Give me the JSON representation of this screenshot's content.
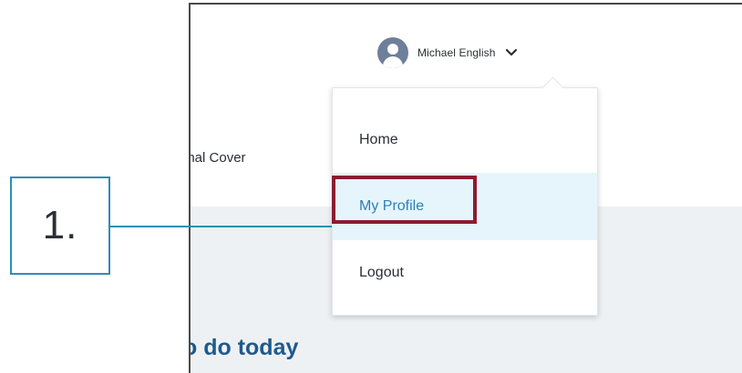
{
  "header": {
    "user_name": "Michael English",
    "avatar_icon": "user-avatar-icon",
    "dropdown_icon": "chevron-down-icon"
  },
  "nav": {
    "partial_text": "onal Cover"
  },
  "dropdown": {
    "items": [
      {
        "label": "Home"
      },
      {
        "label": "My Profile",
        "highlighted": true
      },
      {
        "label": "Logout"
      }
    ]
  },
  "content": {
    "heading_partial": "o do today"
  },
  "callout": {
    "label": "1."
  },
  "colors": {
    "highlight_border": "#8b1c32",
    "callout_accent": "#2a8fb3",
    "profile_text": "#2e7fb8",
    "profile_bg": "#e6f5fb",
    "heading": "#1e5a8c"
  }
}
